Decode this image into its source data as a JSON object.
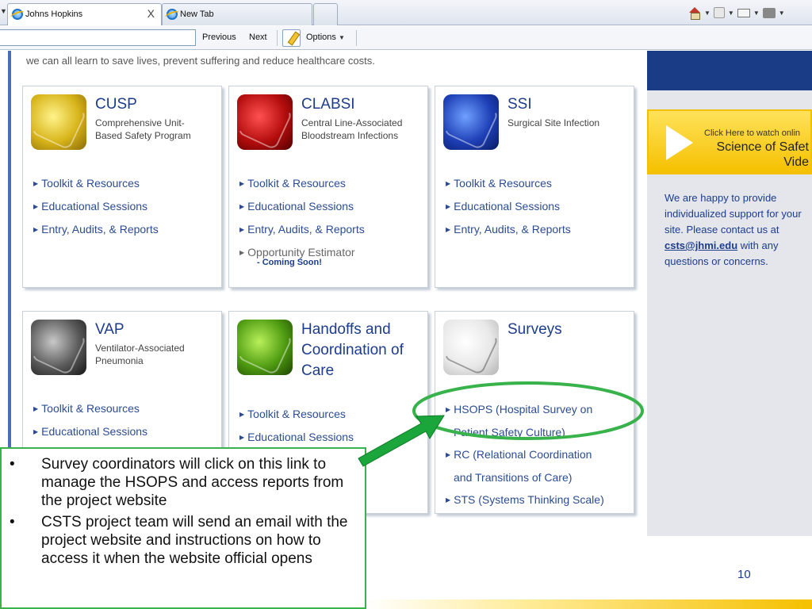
{
  "browser": {
    "tabs": [
      {
        "title": "Johns Hopkins",
        "close": "X"
      },
      {
        "title": "New Tab"
      }
    ],
    "findbar": {
      "previous": "Previous",
      "next": "Next",
      "options": "Options"
    }
  },
  "page": {
    "intro": "we can all learn to save lives, prevent suffering and reduce healthcare costs.",
    "cards": [
      {
        "title": "CUSP",
        "subtitle": [
          "Comprehensive Unit-",
          "Based Safety Program"
        ],
        "links": [
          "Toolkit & Resources",
          "Educational Sessions",
          "Entry, Audits, & Reports"
        ]
      },
      {
        "title": "CLABSI",
        "subtitle": [
          "Central Line-Associated",
          "Bloodstream Infections"
        ],
        "links": [
          "Toolkit & Resources",
          "Educational Sessions",
          "Entry, Audits, & Reports",
          "Opportunity Estimator"
        ],
        "note": "- Coming Soon!"
      },
      {
        "title": "SSI",
        "subtitle": [
          "Surgical Site Infection"
        ],
        "links": [
          "Toolkit & Resources",
          "Educational Sessions",
          "Entry, Audits, & Reports"
        ]
      },
      {
        "title": "VAP",
        "subtitle": [
          "Ventilator-Associated",
          "Pneumonia"
        ],
        "links": [
          "Toolkit & Resources",
          "Educational Sessions"
        ]
      },
      {
        "title": [
          "Handoffs and",
          "Coordination of",
          "Care"
        ],
        "links": [
          "Toolkit & Resources",
          "Educational Sessions"
        ]
      },
      {
        "title": "Surveys",
        "links": [
          {
            "line1": "HSOPS (Hospital Survey on",
            "line2": "Patient Safety Culture)"
          },
          {
            "line1": "RC (Relational Coordination",
            "line2": "and Transitions of Care)"
          },
          {
            "line1": "STS (Systems Thinking Scale)"
          }
        ]
      }
    ],
    "sidebar": {
      "video_small": "Click Here to watch onlin",
      "video_big": [
        "Science of Safet",
        "Vide"
      ],
      "support_before": "We are happy to provide individualized support for your site. Please contact us at ",
      "support_email": "csts@jhmi.edu",
      "support_after": " with any questions or concerns."
    }
  },
  "callout": {
    "bullets": [
      "Survey coordinators will click on this link to manage the HSOPS and access reports from the project website",
      "CSTS project team will send an email with the project website and instructions on how to access it when the website official opens"
    ]
  },
  "slide_number": "10",
  "colors": {
    "accent_green": "#38b24a",
    "link_blue": "#2b4c93",
    "title_blue": "#1c3c8c",
    "banner_blue": "#1a3b85",
    "video_yellow": "#f5c000"
  }
}
